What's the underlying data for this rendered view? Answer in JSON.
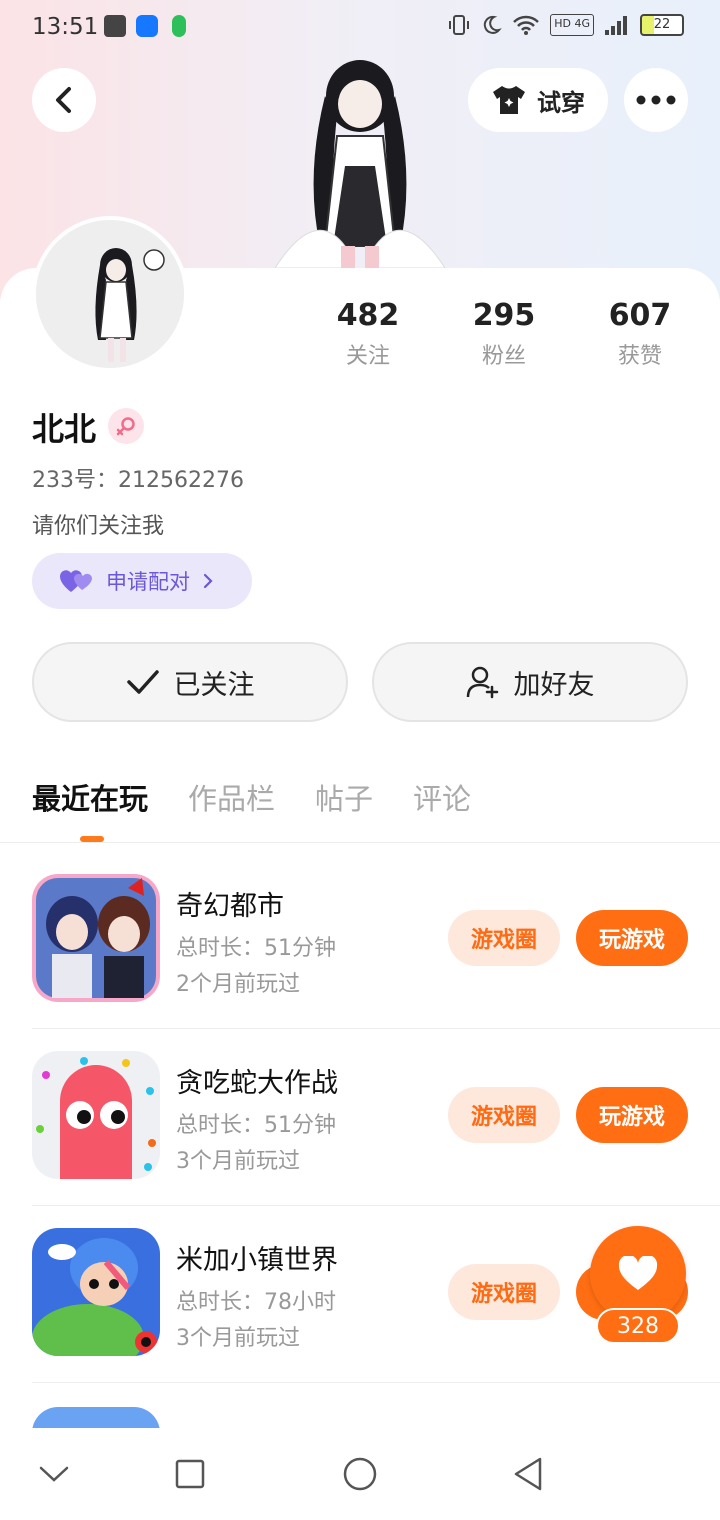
{
  "status_bar": {
    "time": "13:51",
    "network": "HD 4G",
    "battery": "22",
    "icons": [
      "image-icon",
      "shield-icon",
      "mic-icon",
      "vibrate-icon",
      "moon-icon",
      "wifi-icon",
      "signal-icon",
      "battery-icon"
    ]
  },
  "header": {
    "try_on_label": "试穿",
    "icons": [
      "back-arrow-icon",
      "tshirt-icon",
      "more-dots-icon"
    ]
  },
  "profile": {
    "stats": [
      {
        "value": "482",
        "label": "关注"
      },
      {
        "value": "295",
        "label": "粉丝"
      },
      {
        "value": "607",
        "label": "获赞"
      }
    ],
    "nickname": "北北",
    "gender": "female",
    "uid": "233号：212562276",
    "bio": "请你们关注我",
    "pair_label": "申请配对",
    "follow_label": "已关注",
    "add_friend_label": "加好友"
  },
  "tabs": [
    {
      "label": "最近在玩",
      "active": true
    },
    {
      "label": "作品栏",
      "active": false
    },
    {
      "label": "帖子",
      "active": false
    },
    {
      "label": "评论",
      "active": false
    }
  ],
  "games": [
    {
      "name": "奇幻都市",
      "duration": "总时长：51分钟",
      "last_played": "2个月前玩过",
      "circle_label": "游戏圈",
      "play_label": "玩游戏"
    },
    {
      "name": "贪吃蛇大作战",
      "duration": "总时长：51分钟",
      "last_played": "3个月前玩过",
      "circle_label": "游戏圈",
      "play_label": "玩游戏"
    },
    {
      "name": "米加小镇世界",
      "duration": "总时长：78小时",
      "last_played": "3个月前玩过",
      "circle_label": "游戏圈",
      "play_label": "玩游戏"
    }
  ],
  "like": {
    "count": "328"
  },
  "colors": {
    "accent": "#ff6e13",
    "accent_light": "#fee8dc",
    "pair_bg": "#ebe7fb",
    "pair_text": "#6b57d8"
  },
  "nav_icons": [
    "collapse-icon",
    "recents-icon",
    "home-icon",
    "back-icon"
  ]
}
